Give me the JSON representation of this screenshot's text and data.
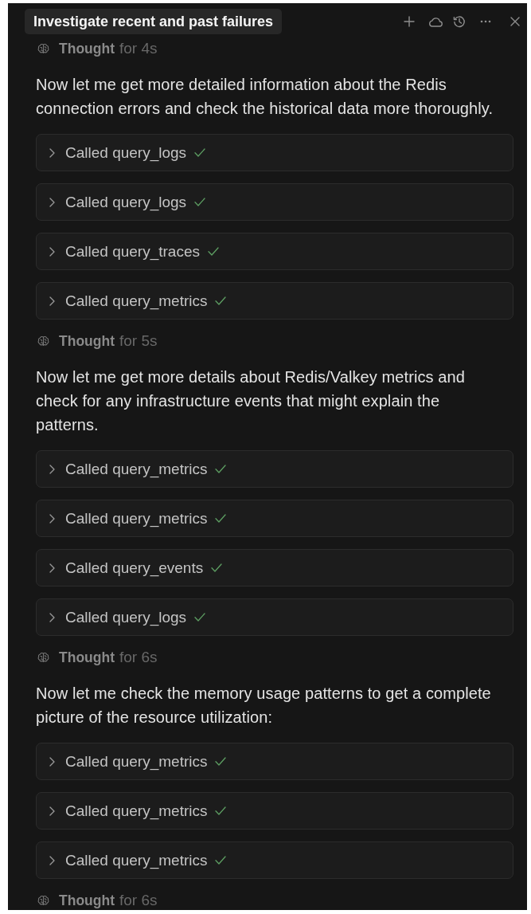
{
  "tab": {
    "title": "Investigate recent and past failures"
  },
  "feed": [
    {
      "kind": "thought",
      "label": "Thought",
      "duration": "for 4s"
    },
    {
      "kind": "message",
      "text": "Now let me get more detailed information about the Redis connection errors and check the historical data more thoroughly."
    },
    {
      "kind": "tool_call",
      "label": "Called query_logs",
      "expanded": false,
      "done": true
    },
    {
      "kind": "tool_call",
      "label": "Called query_logs",
      "expanded": false,
      "done": true
    },
    {
      "kind": "tool_call",
      "label": "Called query_traces",
      "expanded": false,
      "done": true
    },
    {
      "kind": "tool_call",
      "label": "Called query_metrics",
      "expanded": false,
      "done": true
    },
    {
      "kind": "thought",
      "label": "Thought",
      "duration": "for 5s"
    },
    {
      "kind": "message",
      "text": "Now let me get more details about Redis/Valkey metrics and check for any infrastructure events that might explain the patterns."
    },
    {
      "kind": "tool_call",
      "label": "Called query_metrics",
      "expanded": false,
      "done": true
    },
    {
      "kind": "tool_call",
      "label": "Called query_metrics",
      "expanded": false,
      "done": true
    },
    {
      "kind": "tool_call",
      "label": "Called query_events",
      "expanded": false,
      "done": true
    },
    {
      "kind": "tool_call",
      "label": "Called query_logs",
      "expanded": false,
      "done": true
    },
    {
      "kind": "thought",
      "label": "Thought",
      "duration": "for 6s"
    },
    {
      "kind": "message",
      "text": "Now let me check the memory usage patterns to get a complete picture of the resource utilization:"
    },
    {
      "kind": "tool_call",
      "label": "Called query_metrics",
      "expanded": false,
      "done": true
    },
    {
      "kind": "tool_call",
      "label": "Called query_metrics",
      "expanded": false,
      "done": true
    },
    {
      "kind": "tool_call",
      "label": "Called query_metrics",
      "expanded": false,
      "done": true
    },
    {
      "kind": "thought",
      "label": "Thought",
      "duration": "for 6s"
    }
  ]
}
